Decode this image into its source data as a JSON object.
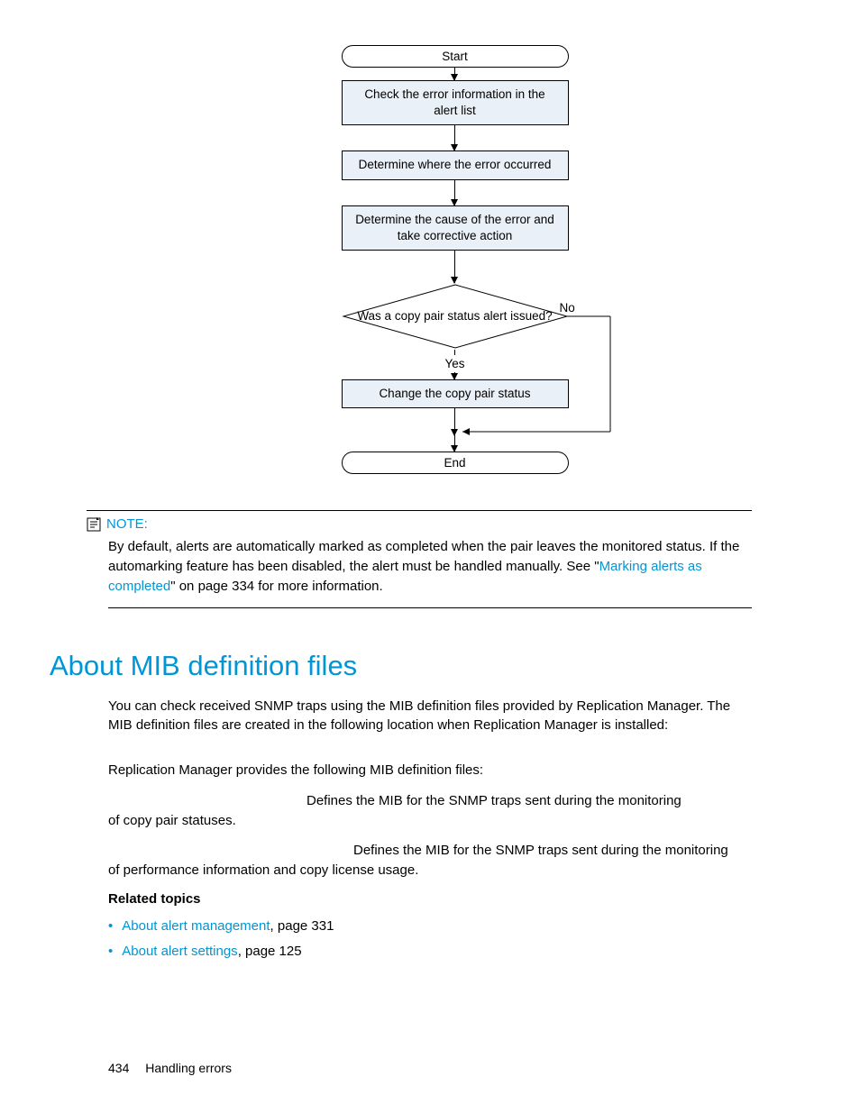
{
  "flowchart": {
    "start": "Start",
    "step1": "Check the error information in the alert list",
    "step2": "Determine where the error occurred",
    "step3": "Determine the cause of the error and take corrective action",
    "decision": "Was a copy pair status alert issued?",
    "no": "No",
    "yes": "Yes",
    "step4": "Change the copy pair status",
    "end": "End"
  },
  "note": {
    "label": "NOTE:",
    "body_pre": "By default, alerts are automatically marked as completed when the pair leaves the monitored status. If the automarking feature has been disabled, the alert must be handled manually. See \"",
    "link": "Marking alerts as completed",
    "body_post": "\" on page 334 for more information."
  },
  "section": {
    "heading": "About MIB definition files",
    "p1": "You can check received SNMP traps using the MIB definition files provided by Replication Manager. The MIB definition files are created in the following location when Replication Manager is installed:",
    "p2": "Replication Manager provides the following MIB definition files:",
    "d1a": "Defines the MIB for the SNMP traps sent during the monitoring",
    "d1b": "of copy pair statuses.",
    "d2a": "Defines the MIB for the SNMP traps sent during the monitoring",
    "d2b": "of performance information and copy license usage."
  },
  "related": {
    "heading": "Related topics",
    "items": [
      {
        "link": "About alert management",
        "suffix": ", page 331"
      },
      {
        "link": "About alert settings",
        "suffix": ", page 125"
      }
    ]
  },
  "footer": {
    "page": "434",
    "title": "Handling errors"
  }
}
